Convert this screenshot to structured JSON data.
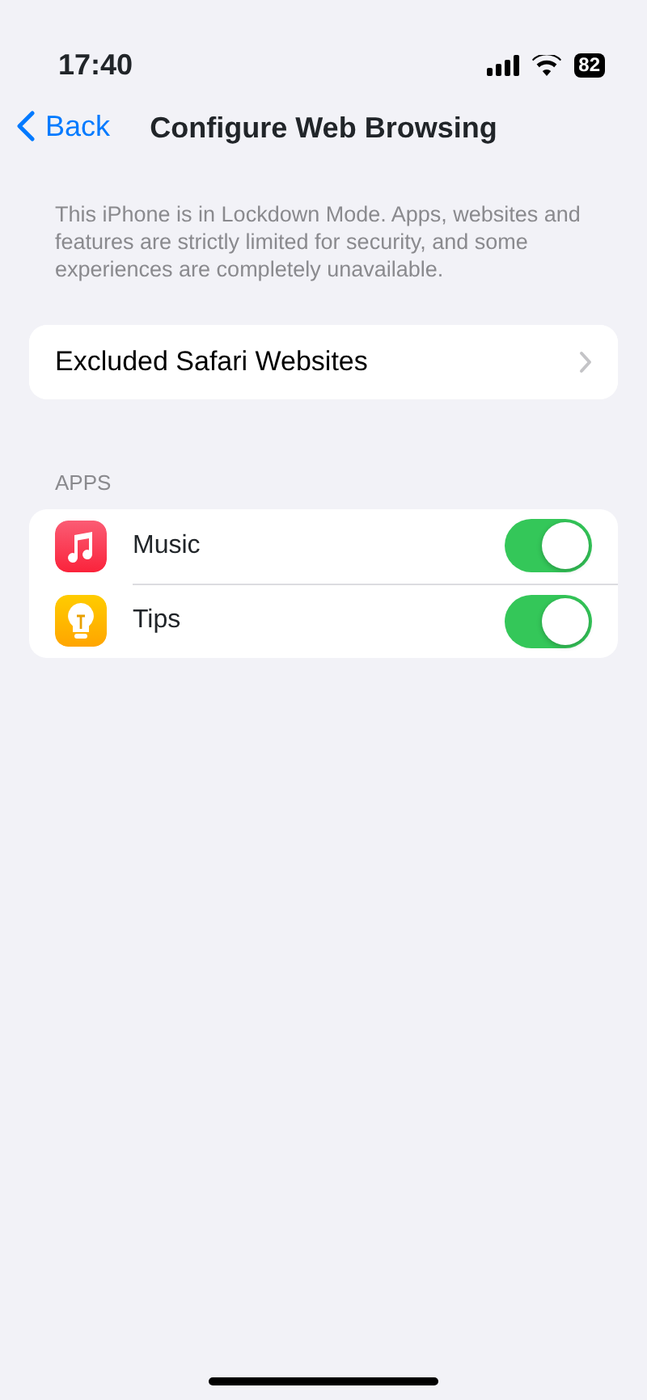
{
  "status_bar": {
    "time": "17:40",
    "battery": "82"
  },
  "nav": {
    "back": "Back",
    "title": "Configure Web Browsing"
  },
  "description": "This iPhone is in Lockdown Mode. Apps, websites and features are strictly limited for security, and some experiences are completely unavailable.",
  "links": [
    {
      "label": "Excluded Safari Websites"
    }
  ],
  "apps": {
    "header": "APPS",
    "items": [
      {
        "kind": "music",
        "label": "Music",
        "on": true
      },
      {
        "kind": "tips",
        "label": "Tips",
        "on": true
      }
    ]
  }
}
